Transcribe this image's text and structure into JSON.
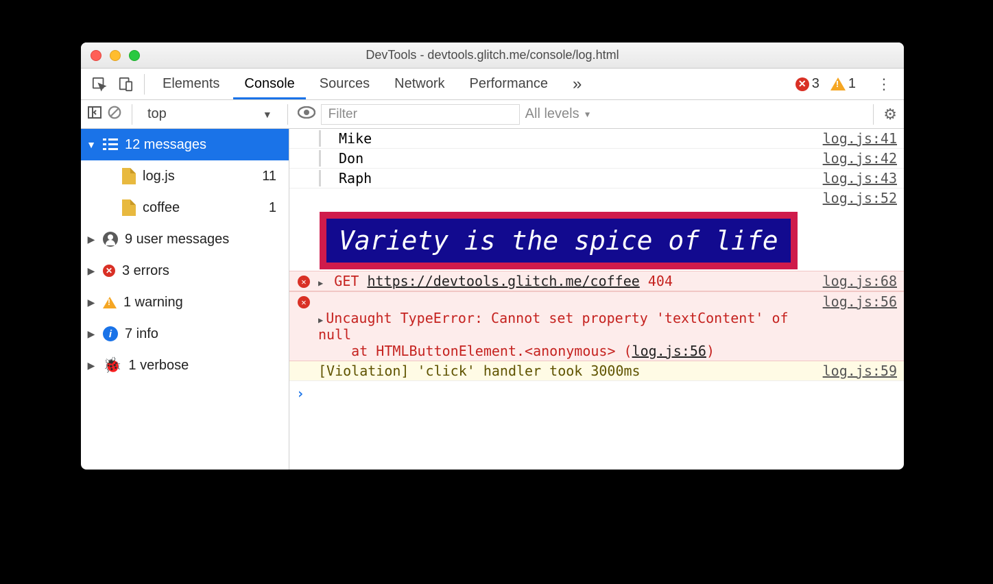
{
  "window": {
    "title": "DevTools - devtools.glitch.me/console/log.html"
  },
  "tabs": {
    "items": [
      "Elements",
      "Console",
      "Sources",
      "Network",
      "Performance"
    ],
    "overflow": "»",
    "active": "Console",
    "error_count": "3",
    "warn_count": "1"
  },
  "toolbar": {
    "context": "top",
    "filter_placeholder": "Filter",
    "levels_label": "All levels"
  },
  "sidebar": {
    "messages": {
      "label": "12 messages"
    },
    "files": [
      {
        "name": "log.js",
        "count": "11"
      },
      {
        "name": "coffee",
        "count": "1"
      }
    ],
    "user": {
      "label": "9 user messages"
    },
    "errors": {
      "label": "3 errors"
    },
    "warning": {
      "label": "1 warning"
    },
    "info": {
      "label": "7 info"
    },
    "verbose": {
      "label": "1 verbose"
    }
  },
  "console": {
    "rows": [
      {
        "text": "Mike",
        "src": "log.js:41"
      },
      {
        "text": "Don",
        "src": "log.js:42"
      },
      {
        "text": "Raph",
        "src": "log.js:43"
      }
    ],
    "styled": {
      "text": "Variety is the spice of life",
      "src": "log.js:52"
    },
    "net_error": {
      "method": "GET",
      "url": "https://devtools.glitch.me/coffee",
      "status": "404",
      "src": "log.js:68"
    },
    "type_error": {
      "head": "Uncaught TypeError: Cannot set property 'textContent' of null",
      "stack_prefix": "    at HTMLButtonElement.<anonymous> (",
      "stack_link": "log.js:56",
      "stack_suffix": ")",
      "src": "log.js:56"
    },
    "violation": {
      "text": "[Violation] 'click' handler took 3000ms",
      "src": "log.js:59"
    },
    "prompt": "›"
  }
}
